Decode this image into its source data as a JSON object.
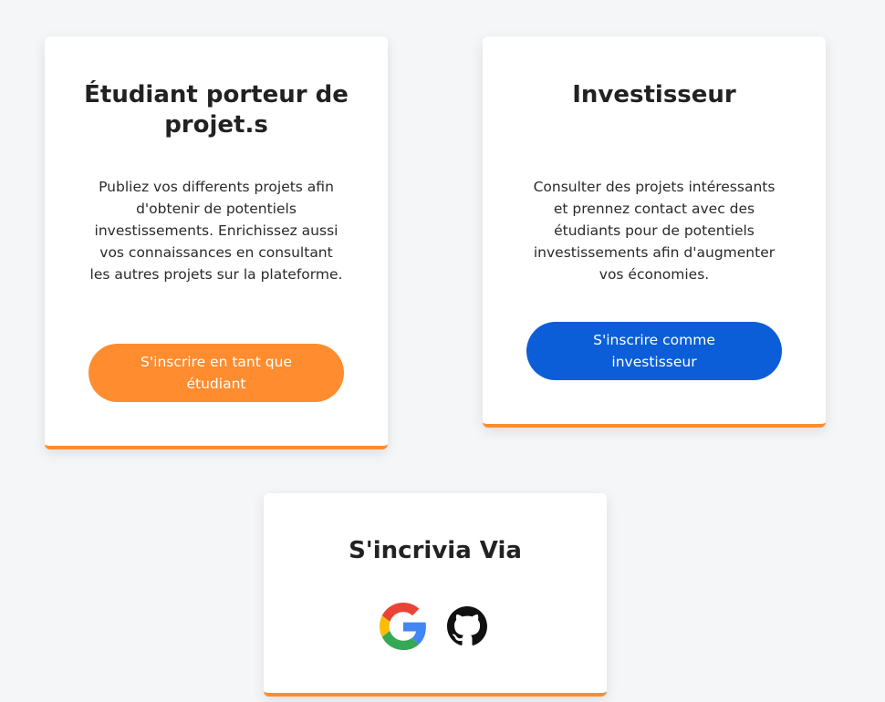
{
  "student_card": {
    "title": "Étudiant porteur de projet.s",
    "description": "Publiez vos differents projets afin d'obtenir de potentiels investissements. Enrichissez aussi vos connaissances en consultant les autres projets sur la plateforme.",
    "button_label": "S'inscrire en tant que étudiant"
  },
  "investor_card": {
    "title": "Investisseur",
    "description": "Consulter des projets intéressants et prennez contact avec des étudiants pour de potentiels investissements afin d'augmenter vos économies.",
    "button_label": "S'inscrire comme investisseur"
  },
  "social_card": {
    "title": "S'incrivia Via",
    "icons": [
      "google-icon",
      "github-icon"
    ]
  },
  "colors": {
    "accent_orange": "#ff8c2e",
    "accent_blue": "#0b5ed7",
    "background": "#f5f6f8"
  }
}
